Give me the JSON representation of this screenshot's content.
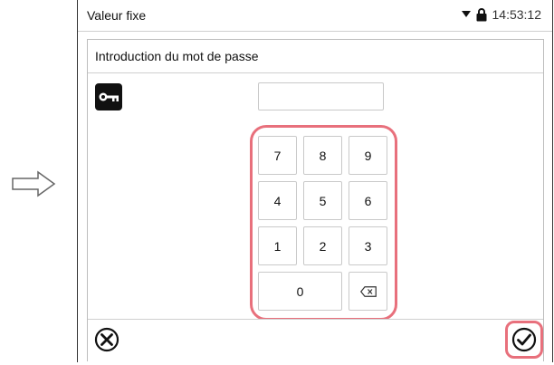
{
  "statusbar": {
    "title": "Valeur fixe",
    "time": "14:53:12",
    "icons": [
      "dropdown-triangle-icon",
      "lock-icon"
    ]
  },
  "dialog": {
    "title": "Introduction du mot de passe",
    "password_value": "",
    "icon": "key-icon"
  },
  "keypad": {
    "keys": [
      "7",
      "8",
      "9",
      "4",
      "5",
      "6",
      "1",
      "2",
      "3",
      "0"
    ],
    "backspace_icon": "backspace-icon"
  },
  "footer": {
    "cancel_icon": "cancel-x-circle-icon",
    "confirm_icon": "check-circle-icon"
  },
  "annotation": {
    "arrow_icon": "right-arrow-icon",
    "highlight_color": "#e8707c"
  }
}
